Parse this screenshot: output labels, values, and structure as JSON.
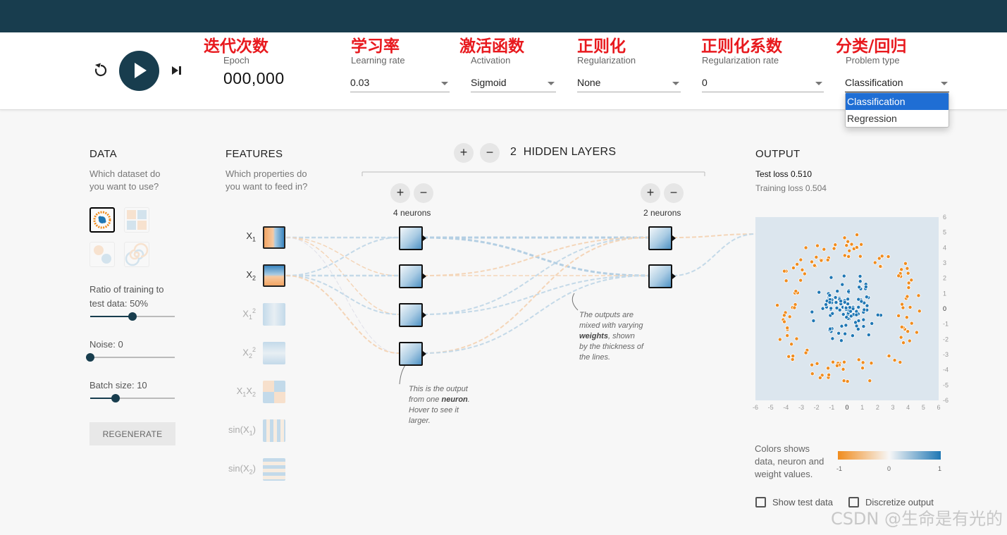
{
  "annotations": {
    "epoch": "迭代次数",
    "learning_rate": "学习率",
    "activation": "激活函数",
    "regularization": "正则化",
    "regularization_rate": "正则化系数",
    "problem_type": "分类/回归"
  },
  "controls": {
    "epoch_label": "Epoch",
    "epoch_value": "000,000",
    "learning_rate": {
      "label": "Learning rate",
      "value": "0.03"
    },
    "activation": {
      "label": "Activation",
      "value": "Sigmoid"
    },
    "regularization": {
      "label": "Regularization",
      "value": "None"
    },
    "regularization_rate": {
      "label": "Regularization rate",
      "value": "0"
    },
    "problem_type": {
      "label": "Problem type",
      "value": "Classification",
      "options": [
        "Classification",
        "Regression"
      ]
    }
  },
  "data_panel": {
    "title": "DATA",
    "subtitle_line1": "Which dataset do",
    "subtitle_line2": "you want to use?",
    "ratio_line1": "Ratio of training to",
    "ratio_line2": "test data:  50%",
    "ratio_value": 0.5,
    "noise_label": "Noise:  0",
    "noise_value": 0,
    "batch_label": "Batch size:  10",
    "batch_value": 0.3,
    "regenerate": "REGENERATE"
  },
  "features_panel": {
    "title": "FEATURES",
    "subtitle_line1": "Which properties do",
    "subtitle_line2": "you want to feed in?",
    "features": [
      {
        "label": "X",
        "sub": "1",
        "sup": "",
        "active": true
      },
      {
        "label": "X",
        "sub": "2",
        "sup": "",
        "active": true
      },
      {
        "label": "X",
        "sub": "1",
        "sup": "2",
        "active": false
      },
      {
        "label": "X",
        "sub": "2",
        "sup": "2",
        "active": false
      },
      {
        "label": "X",
        "sub": "1",
        "label2": "X",
        "sub2": "2",
        "active": false
      },
      {
        "label": "sin(X",
        "sub": "1",
        "tail": ")",
        "active": false
      },
      {
        "label": "sin(X",
        "sub": "2",
        "tail": ")",
        "active": false
      }
    ]
  },
  "network": {
    "hidden_count": "2",
    "hidden_label": "HIDDEN LAYERS",
    "layer1_neurons": "4 neurons",
    "layer2_neurons": "2 neurons",
    "plus": "+",
    "minus": "−",
    "note_neuron_1": "This is the output",
    "note_neuron_2": "from one",
    "note_neuron_bold": "neuron",
    "note_neuron_3": "Hover to see it",
    "note_neuron_4": "larger.",
    "note_weights_1": "The outputs are",
    "note_weights_2": "mixed with varying",
    "note_weights_bold": "weights",
    "note_weights_3": ", shown",
    "note_weights_4": "by the thickness of",
    "note_weights_5": "the lines."
  },
  "output_panel": {
    "title": "OUTPUT",
    "test_loss": "Test loss 0.510",
    "training_loss": "Training loss 0.504",
    "legend_line1": "Colors shows",
    "legend_line2": "data, neuron and",
    "legend_line3": "weight values.",
    "scale_min": "-1",
    "scale_mid": "0",
    "scale_max": "1",
    "show_test_data": "Show test data",
    "discretize_output": "Discretize output",
    "x_ticks": [
      "-6",
      "-5",
      "-4",
      "-3",
      "-2",
      "-1",
      "0",
      "1",
      "2",
      "3",
      "4",
      "5",
      "6"
    ],
    "y_ticks": [
      "6",
      "5",
      "4",
      "3",
      "2",
      "1",
      "0",
      "-1",
      "-2",
      "-3",
      "-4",
      "-5",
      "-6"
    ]
  },
  "watermark": "CSDN @生命是有光的",
  "colors": {
    "blue": "#1f77b4",
    "orange": "#f08c1e",
    "dark": "#183d4e"
  },
  "icons": {
    "reset": "reset-icon",
    "play": "play-icon",
    "step": "step-forward-icon"
  }
}
